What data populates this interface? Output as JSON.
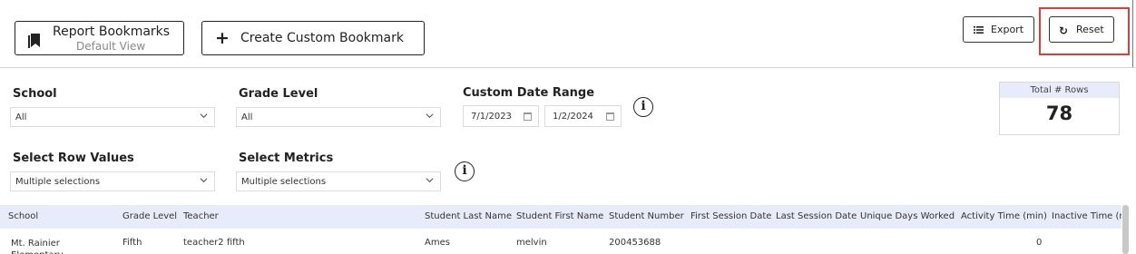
{
  "toolbar": {
    "bookmarks_title": "Report Bookmarks",
    "bookmarks_subtitle": "Default View",
    "create_custom_label": "Create Custom Bookmark",
    "export_label": "Export",
    "reset_label": "Reset",
    "highlight_color": "#e03a3a"
  },
  "filters": {
    "school": {
      "label": "School",
      "value": "All"
    },
    "grade_level": {
      "label": "Grade Level",
      "value": "All"
    },
    "date_range": {
      "label": "Custom Date Range",
      "start": "7/1/2023",
      "end": "1/2/2024"
    },
    "row_values": {
      "label": "Select Row Values",
      "value": "Multiple selections"
    },
    "metrics": {
      "label": "Select Metrics",
      "value": "Multiple selections"
    }
  },
  "summary": {
    "total_rows_label": "Total # Rows",
    "total_rows_value": "78",
    "header_color": "#e8ecfa"
  },
  "table": {
    "columns": [
      "School",
      "Grade Level",
      "Teacher",
      "Student Last Name",
      "Student First Name",
      "Student Number",
      "First Session Date",
      "Last Session Date",
      "Unique Days Worked",
      "Activity Time (min)",
      "Inactive Time (m"
    ],
    "rows": [
      [
        "Mt. Rainier Elementary",
        "Fifth",
        "teacher2 fifth",
        "Ames",
        "melvin",
        "200453688",
        "",
        "",
        "",
        "0",
        ""
      ]
    ]
  },
  "icons": {
    "bookmark": "bookmark-icon",
    "plus": "plus-icon",
    "export": "list-icon",
    "reset": "refresh-icon",
    "info": "info-icon",
    "chevron": "chevron-down-icon",
    "calendar": "calendar-icon"
  }
}
